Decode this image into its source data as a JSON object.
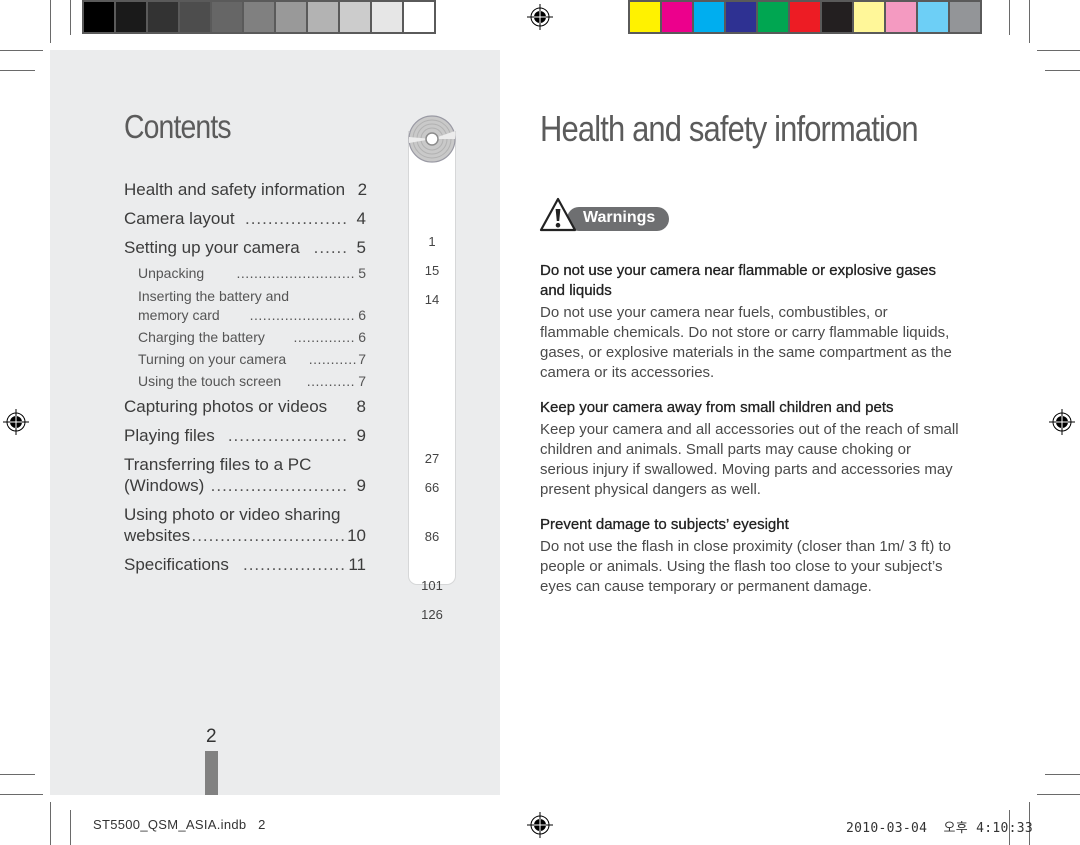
{
  "color_bars": {
    "grayscale": [
      "#000000",
      "#1a1a1a",
      "#333333",
      "#4d4d4d",
      "#666666",
      "#808080",
      "#999999",
      "#b3b3b3",
      "#cccccc",
      "#e6e6e6",
      "#ffffff"
    ],
    "process": [
      "#fff200",
      "#ec008c",
      "#00aeef",
      "#2e3192",
      "#00a651",
      "#ed1c24",
      "#231f20",
      "#fff799",
      "#f49ac1",
      "#6dcff6",
      "#939598"
    ]
  },
  "contents": {
    "title": "Contents",
    "entries": [
      {
        "label": "Health and safety information",
        "page": "2",
        "tab": "1"
      },
      {
        "label": "Camera layout",
        "dots": "..................",
        "page": "4",
        "tab": "15"
      },
      {
        "label": "Setting up your camera",
        "dots": "......",
        "page": "5",
        "tab": "14"
      },
      {
        "label": "Capturing photos or videos",
        "page": "8",
        "tab": "27"
      },
      {
        "label": "Playing files",
        "dots": ".....................",
        "page": "9",
        "tab": "66"
      },
      {
        "label_line1": "Transferring files to a PC",
        "label": "(Windows)",
        "dots": "........................",
        "page": "9",
        "tab": "86"
      },
      {
        "label_line1": "Using photo or video sharing",
        "label": "websites",
        "dots": "...........................",
        "page": "10",
        "tab": "101"
      },
      {
        "label": "Specifications",
        "dots": "..................",
        "page": "11",
        "tab": "126"
      }
    ],
    "sub_entries": [
      {
        "label": "Unpacking",
        "dots": "...........................",
        "page": "5"
      },
      {
        "label_line1": "Inserting the battery and",
        "label": "memory card",
        "dots": "........................",
        "page": "6"
      },
      {
        "label": "Charging the battery",
        "dots": "..............",
        "page": "6"
      },
      {
        "label": "Turning on your camera",
        "dots": "...........",
        "page": "7"
      },
      {
        "label": "Using the touch screen",
        "dots": "...........",
        "page": "7"
      }
    ],
    "page_number": "2"
  },
  "health": {
    "title": "Health and safety information",
    "warning_label": "Warnings",
    "sections": [
      {
        "heading": "Do not use your camera near flammable or explosive gases and liquids",
        "body": "Do not use your camera near fuels, combustibles, or flammable chemicals. Do not store or carry flammable liquids, gases, or explosive materials in the same compartment as the camera or its accessories."
      },
      {
        "heading": "Keep your camera away from small children and pets",
        "body": "Keep your camera and all accessories out of the reach of small children and animals. Small parts may cause choking or serious injury if swallowed. Moving parts and accessories may present physical dangers as well."
      },
      {
        "heading": "Prevent damage to subjects’ eyesight",
        "body": "Do not use the flash in close proximity (closer than 1m/ 3 ft) to people or animals. Using the flash too close to your subject’s eyes can cause temporary or permanent damage."
      }
    ]
  },
  "footer": {
    "file": "ST5500_QSM_ASIA.indb   2",
    "date": "2010-03-04  오후 4:10:33"
  }
}
